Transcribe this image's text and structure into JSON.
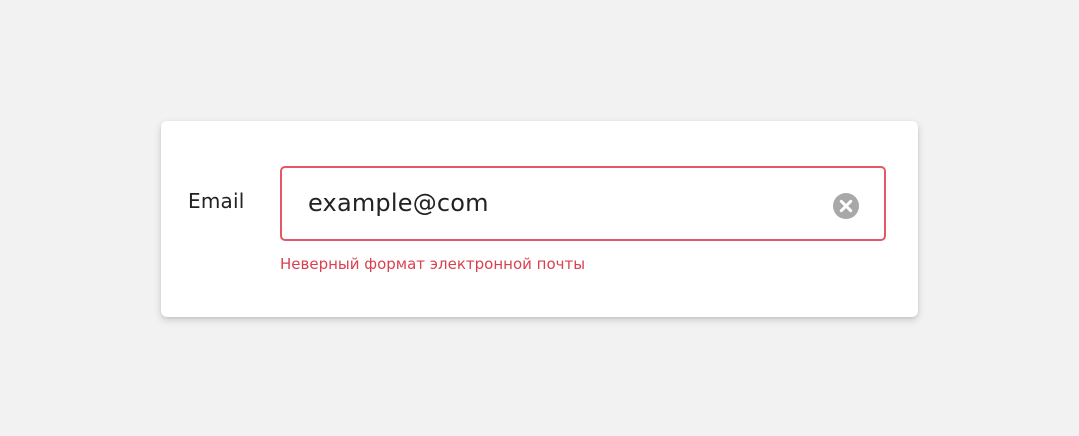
{
  "form": {
    "email_label": "Email",
    "email_value": "example@com",
    "error_message": "Неверный формат электронной почты"
  },
  "icons": {
    "clear": "close-circle-icon"
  },
  "colors": {
    "background": "#f2f2f2",
    "card": "#ffffff",
    "error_border": "#e25866",
    "error_text": "#d9414f",
    "clear_icon": "#a8a8a8"
  }
}
